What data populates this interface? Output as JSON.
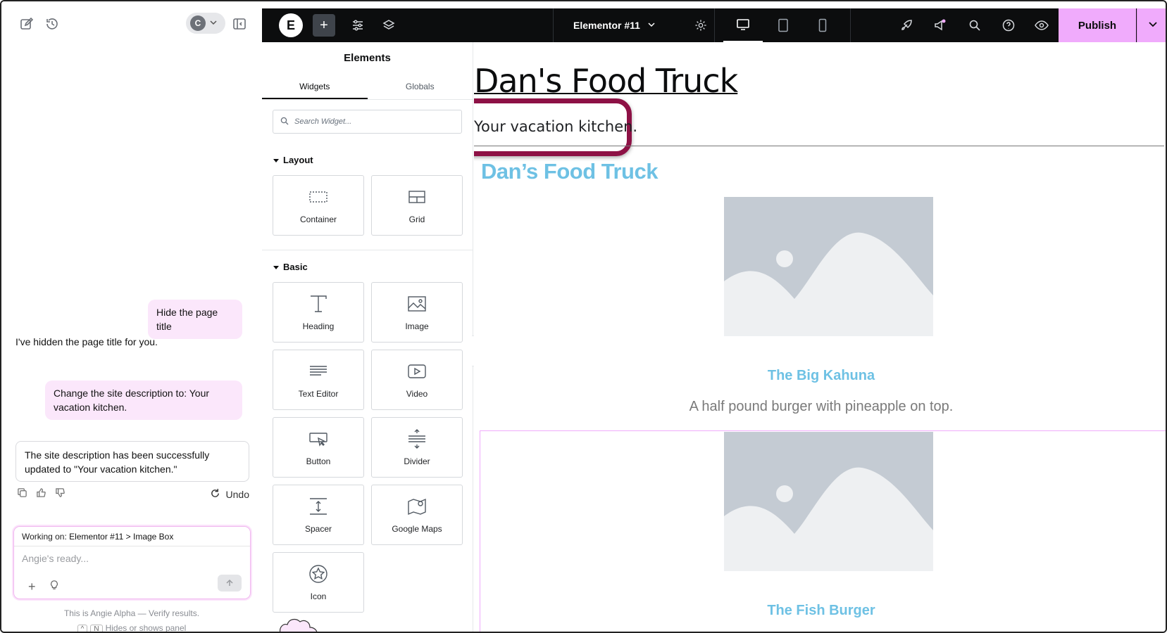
{
  "angie": {
    "avatar_letter": "C",
    "messages": [
      {
        "role": "user",
        "text": "Hide the page title"
      },
      {
        "role": "ai",
        "text": "I've hidden the page title for you."
      },
      {
        "role": "user",
        "text": "Change the site description to: Your vacation kitchen."
      },
      {
        "role": "ai",
        "text": "The site description has been successfully updated to \"Your vacation kitchen.\""
      }
    ],
    "undo_label": "Undo",
    "working_on_label": "Working on:",
    "working_on_value": "Elementor #11 > Image Box",
    "input_placeholder": "Angie's ready...",
    "alpha_note": "This is Angie Alpha — Verify results.",
    "shortcut_keys": [
      "^",
      "N"
    ],
    "shortcut_hint": "Hides or shows panel"
  },
  "topbar": {
    "logo": "E",
    "add": "+",
    "document_title": "Elementor #11",
    "publish_label": "Publish"
  },
  "panel": {
    "title": "Elements",
    "tabs": [
      "Widgets",
      "Globals"
    ],
    "search_placeholder": "Search Widget...",
    "categories": [
      {
        "name": "Layout",
        "widgets": [
          "Container",
          "Grid"
        ]
      },
      {
        "name": "Basic",
        "widgets": [
          "Heading",
          "Image",
          "Text Editor",
          "Video",
          "Button",
          "Divider",
          "Spacer",
          "Google Maps",
          "Icon"
        ]
      }
    ]
  },
  "canvas": {
    "site_title": "Dan's Food Truck",
    "site_description": "Your vacation kitchen.",
    "brand_heading": "Dan’s Food Truck",
    "image_boxes": [
      {
        "title": "The Big Kahuna",
        "text": "A half pound burger with pineapple on top."
      },
      {
        "title": "The Fish Burger",
        "text": ""
      }
    ]
  },
  "colors": {
    "accent_pink": "#f0abfc",
    "highlight_ring": "#8d1145",
    "brand_blue": "#6ec1e4",
    "user_bubble": "#fbe7fb"
  }
}
